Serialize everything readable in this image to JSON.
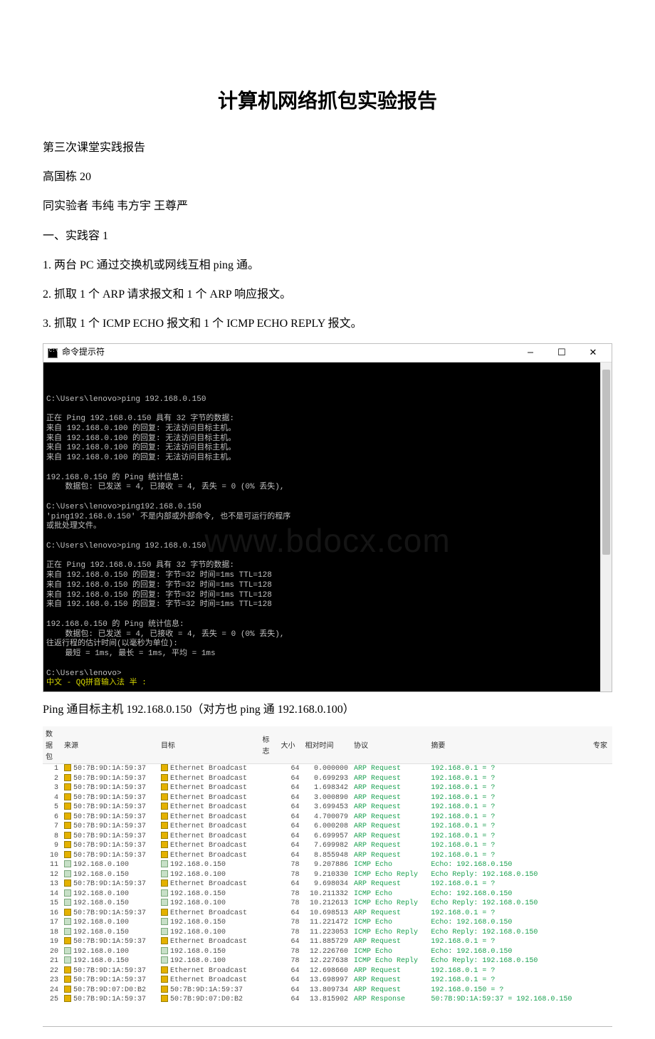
{
  "title": "计算机网络抓包实验报告",
  "paragraphs": {
    "p1": "第三次课堂实践报告",
    "p2": "高国栋 20",
    "p3": "同实验者 韦纯 韦方宇 王尊严",
    "p4": "一、实践容 1",
    "p5": "1. 两台 PC 通过交换机或网线互相 ping 通。",
    "p6": "2. 抓取 1 个 ARP 请求报文和 1 个 ARP 响应报文。",
    "p7": "3. 抓取 1 个 ICMP ECHO 报文和 1 个 ICMP ECHO REPLY 报文。",
    "caption": "Ping 通目标主机 192.168.0.150（对方也 ping 通 192.168.0.100）"
  },
  "terminal": {
    "window_title": "命令提示符",
    "watermark": "www.bdocx.com",
    "lines": [
      "C:\\Users\\lenovo>ping 192.168.0.150",
      "",
      "正在 Ping 192.168.0.150 具有 32 字节的数据:",
      "来自 192.168.0.100 的回复: 无法访问目标主机。",
      "来自 192.168.0.100 的回复: 无法访问目标主机。",
      "来自 192.168.0.100 的回复: 无法访问目标主机。",
      "来自 192.168.0.100 的回复: 无法访问目标主机。",
      "",
      "192.168.0.150 的 Ping 统计信息:",
      "    数据包: 已发送 = 4, 已接收 = 4, 丢失 = 0 (0% 丢失),",
      "",
      "C:\\Users\\lenovo>ping192.168.0.150",
      "'ping192.168.0.150' 不是内部或外部命令, 也不是可运行的程序",
      "或批处理文件。",
      "",
      "C:\\Users\\lenovo>ping 192.168.0.150",
      "",
      "正在 Ping 192.168.0.150 具有 32 字节的数据:",
      "来自 192.168.0.150 的回复: 字节=32 时间=1ms TTL=128",
      "来自 192.168.0.150 的回复: 字节=32 时间=1ms TTL=128",
      "来自 192.168.0.150 的回复: 字节=32 时间=1ms TTL=128",
      "来自 192.168.0.150 的回复: 字节=32 时间=1ms TTL=128",
      "",
      "192.168.0.150 的 Ping 统计信息:",
      "    数据包: 已发送 = 4, 已接收 = 4, 丢失 = 0 (0% 丢失),",
      "往返行程的估计时间(以毫秒为单位):",
      "    最短 = 1ms, 最长 = 1ms, 平均 = 1ms",
      "",
      "C:\\Users\\lenovo>"
    ],
    "ime_line": "中文 - QQ拼音输入法 半 :"
  },
  "capture": {
    "headers": [
      "数据包",
      "来源",
      "目标",
      "标志",
      "大小",
      "相对时间",
      "协议",
      "摘要",
      "专家"
    ],
    "rows": [
      {
        "n": 1,
        "src": "50:7B:9D:1A:59:37",
        "srct": "mac",
        "dst": "Ethernet Broadcast",
        "dstt": "mac",
        "size": 64,
        "time": "0.000000",
        "proto": "ARP Request",
        "sum": "192.168.0.1 = ?"
      },
      {
        "n": 2,
        "src": "50:7B:9D:1A:59:37",
        "srct": "mac",
        "dst": "Ethernet Broadcast",
        "dstt": "mac",
        "size": 64,
        "time": "0.699293",
        "proto": "ARP Request",
        "sum": "192.168.0.1 = ?"
      },
      {
        "n": 3,
        "src": "50:7B:9D:1A:59:37",
        "srct": "mac",
        "dst": "Ethernet Broadcast",
        "dstt": "mac",
        "size": 64,
        "time": "1.698342",
        "proto": "ARP Request",
        "sum": "192.168.0.1 = ?"
      },
      {
        "n": 4,
        "src": "50:7B:9D:1A:59:37",
        "srct": "mac",
        "dst": "Ethernet Broadcast",
        "dstt": "mac",
        "size": 64,
        "time": "3.000890",
        "proto": "ARP Request",
        "sum": "192.168.0.1 = ?"
      },
      {
        "n": 5,
        "src": "50:7B:9D:1A:59:37",
        "srct": "mac",
        "dst": "Ethernet Broadcast",
        "dstt": "mac",
        "size": 64,
        "time": "3.699453",
        "proto": "ARP Request",
        "sum": "192.168.0.1 = ?"
      },
      {
        "n": 6,
        "src": "50:7B:9D:1A:59:37",
        "srct": "mac",
        "dst": "Ethernet Broadcast",
        "dstt": "mac",
        "size": 64,
        "time": "4.700079",
        "proto": "ARP Request",
        "sum": "192.168.0.1 = ?"
      },
      {
        "n": 7,
        "src": "50:7B:9D:1A:59:37",
        "srct": "mac",
        "dst": "Ethernet Broadcast",
        "dstt": "mac",
        "size": 64,
        "time": "6.000208",
        "proto": "ARP Request",
        "sum": "192.168.0.1 = ?"
      },
      {
        "n": 8,
        "src": "50:7B:9D:1A:59:37",
        "srct": "mac",
        "dst": "Ethernet Broadcast",
        "dstt": "mac",
        "size": 64,
        "time": "6.699957",
        "proto": "ARP Request",
        "sum": "192.168.0.1 = ?"
      },
      {
        "n": 9,
        "src": "50:7B:9D:1A:59:37",
        "srct": "mac",
        "dst": "Ethernet Broadcast",
        "dstt": "mac",
        "size": 64,
        "time": "7.699982",
        "proto": "ARP Request",
        "sum": "192.168.0.1 = ?"
      },
      {
        "n": 10,
        "src": "50:7B:9D:1A:59:37",
        "srct": "mac",
        "dst": "Ethernet Broadcast",
        "dstt": "mac",
        "size": 64,
        "time": "8.855948",
        "proto": "ARP Request",
        "sum": "192.168.0.1 = ?"
      },
      {
        "n": 11,
        "src": "192.168.0.100",
        "srct": "ip",
        "dst": "192.168.0.150",
        "dstt": "ip",
        "size": 78,
        "time": "9.207886",
        "proto": "ICMP Echo",
        "sum": "Echo: 192.168.0.150"
      },
      {
        "n": 12,
        "src": "192.168.0.150",
        "srct": "ip",
        "dst": "192.168.0.100",
        "dstt": "ip",
        "size": 78,
        "time": "9.210330",
        "proto": "ICMP Echo Reply",
        "sum": "Echo Reply: 192.168.0.150"
      },
      {
        "n": 13,
        "src": "50:7B:9D:1A:59:37",
        "srct": "mac",
        "dst": "Ethernet Broadcast",
        "dstt": "mac",
        "size": 64,
        "time": "9.698034",
        "proto": "ARP Request",
        "sum": "192.168.0.1 = ?"
      },
      {
        "n": 14,
        "src": "192.168.0.100",
        "srct": "ip",
        "dst": "192.168.0.150",
        "dstt": "ip",
        "size": 78,
        "time": "10.211332",
        "proto": "ICMP Echo",
        "sum": "Echo: 192.168.0.150"
      },
      {
        "n": 15,
        "src": "192.168.0.150",
        "srct": "ip",
        "dst": "192.168.0.100",
        "dstt": "ip",
        "size": 78,
        "time": "10.212613",
        "proto": "ICMP Echo Reply",
        "sum": "Echo Reply: 192.168.0.150"
      },
      {
        "n": 16,
        "src": "50:7B:9D:1A:59:37",
        "srct": "mac",
        "dst": "Ethernet Broadcast",
        "dstt": "mac",
        "size": 64,
        "time": "10.698513",
        "proto": "ARP Request",
        "sum": "192.168.0.1 = ?"
      },
      {
        "n": 17,
        "src": "192.168.0.100",
        "srct": "ip",
        "dst": "192.168.0.150",
        "dstt": "ip",
        "size": 78,
        "time": "11.221472",
        "proto": "ICMP Echo",
        "sum": "Echo: 192.168.0.150"
      },
      {
        "n": 18,
        "src": "192.168.0.150",
        "srct": "ip",
        "dst": "192.168.0.100",
        "dstt": "ip",
        "size": 78,
        "time": "11.223053",
        "proto": "ICMP Echo Reply",
        "sum": "Echo Reply: 192.168.0.150"
      },
      {
        "n": 19,
        "src": "50:7B:9D:1A:59:37",
        "srct": "mac",
        "dst": "Ethernet Broadcast",
        "dstt": "mac",
        "size": 64,
        "time": "11.885729",
        "proto": "ARP Request",
        "sum": "192.168.0.1 = ?"
      },
      {
        "n": 20,
        "src": "192.168.0.100",
        "srct": "ip",
        "dst": "192.168.0.150",
        "dstt": "ip",
        "size": 78,
        "time": "12.226760",
        "proto": "ICMP Echo",
        "sum": "Echo: 192.168.0.150"
      },
      {
        "n": 21,
        "src": "192.168.0.150",
        "srct": "ip",
        "dst": "192.168.0.100",
        "dstt": "ip",
        "size": 78,
        "time": "12.227638",
        "proto": "ICMP Echo Reply",
        "sum": "Echo Reply: 192.168.0.150"
      },
      {
        "n": 22,
        "src": "50:7B:9D:1A:59:37",
        "srct": "mac",
        "dst": "Ethernet Broadcast",
        "dstt": "mac",
        "size": 64,
        "time": "12.698660",
        "proto": "ARP Request",
        "sum": "192.168.0.1 = ?"
      },
      {
        "n": 23,
        "src": "50:7B:9D:1A:59:37",
        "srct": "mac",
        "dst": "Ethernet Broadcast",
        "dstt": "mac",
        "size": 64,
        "time": "13.698997",
        "proto": "ARP Request",
        "sum": "192.168.0.1 = ?"
      },
      {
        "n": 24,
        "src": "50:7B:9D:07:D0:B2",
        "srct": "mac",
        "dst": "50:7B:9D:1A:59:37",
        "dstt": "mac",
        "size": 64,
        "time": "13.809734",
        "proto": "ARP Request",
        "sum": "192.168.0.150 = ?"
      },
      {
        "n": 25,
        "src": "50:7B:9D:1A:59:37",
        "srct": "mac",
        "dst": "50:7B:9D:07:D0:B2",
        "dstt": "mac",
        "size": 64,
        "time": "13.815902",
        "proto": "ARP Response",
        "sum": "50:7B:9D:1A:59:37 = 192.168.0.150"
      }
    ]
  }
}
